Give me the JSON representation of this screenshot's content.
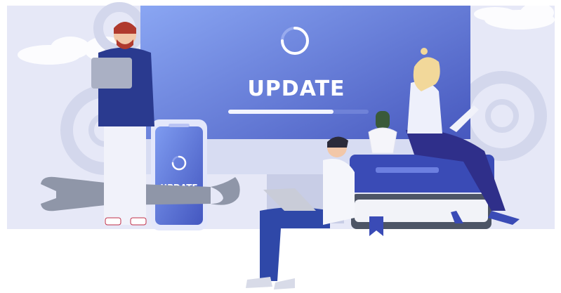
{
  "illustration": {
    "monitor_title": "UPDATE",
    "phone_title": "UPDATE",
    "monitor_progress": 0.75,
    "phone_progress": 0.8,
    "colors": {
      "background_panel": "#e6e8f7",
      "monitor_light": "#7e9bf0",
      "monitor_dark": "#4f63c8",
      "gear": "#d9dcef",
      "wrench": "#8f96a8",
      "book_top": "#3a4bb6",
      "book_bottom": "#4d5566",
      "shirt": "#2a3a8f",
      "skin": "#f2c7a8"
    }
  }
}
